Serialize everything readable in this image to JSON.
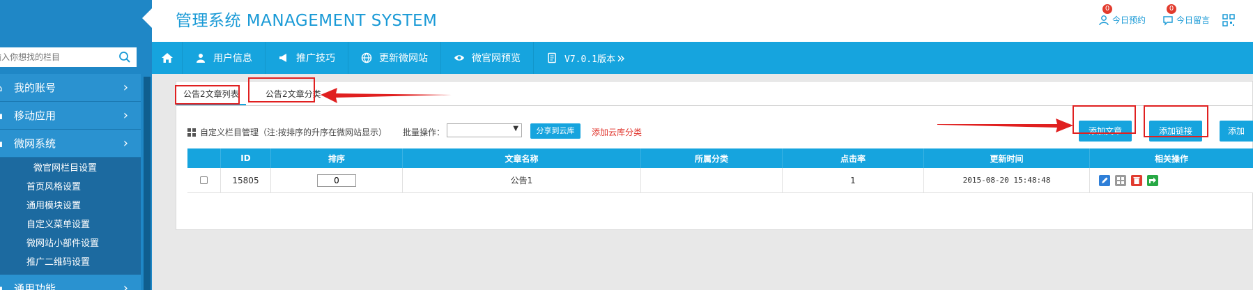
{
  "header": {
    "title": "管理系统 MANAGEMENT SYSTEM",
    "links": [
      {
        "label": "今日预约",
        "badge": "0"
      },
      {
        "label": "今日留言",
        "badge": "0"
      }
    ]
  },
  "sidebar": {
    "search_placeholder": "输入你想找的栏目",
    "items": [
      {
        "label": "我的账号"
      },
      {
        "label": "移动应用"
      },
      {
        "label": "微网系统"
      }
    ],
    "submenu": [
      "微官网栏目设置",
      "首页风格设置",
      "通用模块设置",
      "自定义菜单设置",
      "微网站小部件设置",
      "推广二维码设置"
    ],
    "bottom_item": "通用功能"
  },
  "nav": {
    "items": [
      {
        "label": "用户信息",
        "icon": "user-icon"
      },
      {
        "label": "推广技巧",
        "icon": "megaphone-icon"
      },
      {
        "label": "更新微网站",
        "icon": "globe-icon"
      },
      {
        "label": "微官网预览",
        "icon": "eye-icon"
      },
      {
        "label": "V7.0.1版本",
        "icon": "document-icon"
      }
    ],
    "more": "»"
  },
  "tabs": [
    {
      "label": "公告2文章列表",
      "active": true
    },
    {
      "label": "公告2文章分类",
      "active": false
    }
  ],
  "toolbar": {
    "manage_label": "自定义栏目管理（注:按排序的升序在微网站显示）",
    "batch_label": "批量操作：",
    "select_value": "",
    "share_button": "分享到云库",
    "add_cloud_link": "添加云库分类",
    "add_article_button": "添加文章",
    "add_link_button": "添加链接",
    "third_button": "添加"
  },
  "table": {
    "headers": [
      "",
      "ID",
      "排序",
      "文章名称",
      "所属分类",
      "点击率",
      "更新时间",
      "相关操作"
    ],
    "rows": [
      {
        "id": "15805",
        "sort": "0",
        "name": "公告1",
        "category": "",
        "clicks": "1",
        "updated": "2015-08-20 15:48:48"
      }
    ]
  },
  "colors": {
    "accent": "#16a4de",
    "sidebar": "#1f87c6",
    "annotation": "#e02020"
  }
}
